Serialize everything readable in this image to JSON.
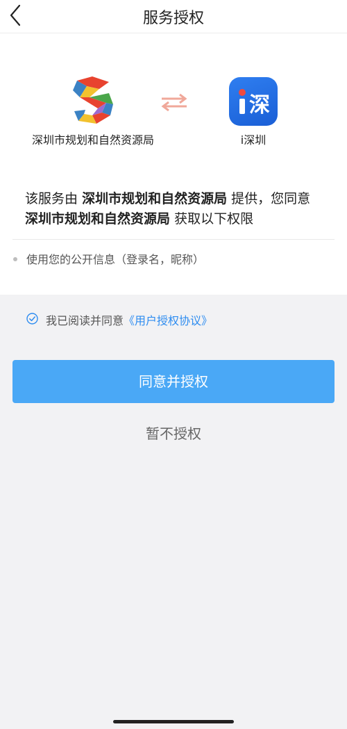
{
  "header": {
    "title": "服务授权",
    "back_icon": "chevron-left-icon"
  },
  "provider": {
    "name": "深圳市规划和自然资源局",
    "logo_icon": "planning-bureau-logo-icon"
  },
  "swap_icon": "swap-arrows-icon",
  "app": {
    "name": "i深圳",
    "logo_text": "i深",
    "logo_icon": "ishenzhen-logo-icon",
    "brand_color": "#2f7ef0"
  },
  "description": {
    "prefix": "该服务由",
    "provider_bold": "深圳市规划和自然资源局",
    "middle": "提供，您同意",
    "provider_bold_2": "深圳市规划和自然资源局",
    "suffix": "获取以下权限"
  },
  "permissions": [
    {
      "label": "使用您的公开信息（登录名，昵称）"
    }
  ],
  "agreement": {
    "prefix": "我已阅读并同意",
    "link": "《用户授权协议》",
    "checked": true,
    "link_color": "#2d8cf0"
  },
  "buttons": {
    "agree": "同意并授权",
    "decline": "暂不授权",
    "agree_color": "#4aa8f6"
  }
}
